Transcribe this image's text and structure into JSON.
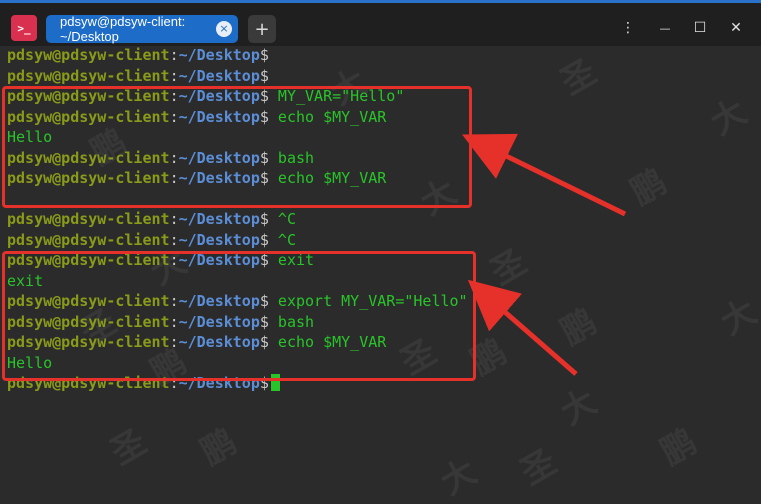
{
  "window": {
    "app_icon_glyph": ">_",
    "tab_title": "pdsyw@pdsyw-client: ~/Desktop",
    "tab_close_glyph": "×",
    "new_tab_glyph": "+",
    "menu_glyph": "⋮",
    "minimize_glyph": "—",
    "maximize_glyph": "☐",
    "close_glyph": "✕"
  },
  "prompt": {
    "user_host": "pdsyw@pdsyw-client",
    "colon": ":",
    "path": "~/Desktop",
    "dollar": "$"
  },
  "lines": [
    {
      "type": "prompt",
      "cmd": ""
    },
    {
      "type": "prompt",
      "cmd": ""
    },
    {
      "type": "prompt",
      "cmd": " MY_VAR=\"Hello\""
    },
    {
      "type": "prompt",
      "cmd": " echo $MY_VAR"
    },
    {
      "type": "output",
      "text": "Hello"
    },
    {
      "type": "prompt",
      "cmd": " bash"
    },
    {
      "type": "prompt",
      "cmd": " echo $MY_VAR"
    },
    {
      "type": "output",
      "text": ""
    },
    {
      "type": "prompt",
      "cmd": " ^C"
    },
    {
      "type": "prompt",
      "cmd": " ^C"
    },
    {
      "type": "prompt",
      "cmd": " exit"
    },
    {
      "type": "output",
      "text": "exit"
    },
    {
      "type": "prompt",
      "cmd": " export MY_VAR=\"Hello\""
    },
    {
      "type": "prompt",
      "cmd": " bash"
    },
    {
      "type": "prompt",
      "cmd": " echo $MY_VAR"
    },
    {
      "type": "output",
      "text": "Hello"
    },
    {
      "type": "prompt",
      "cmd": "",
      "cursor": true
    }
  ],
  "colors": {
    "highlight": "#e6302a",
    "tab_active": "#1c6cc8",
    "output_green": "#29c429"
  },
  "watermark": {
    "chars": [
      "鹏",
      "大",
      "圣"
    ]
  }
}
